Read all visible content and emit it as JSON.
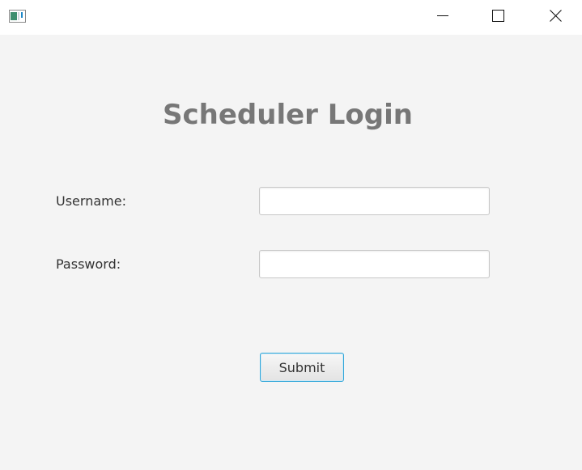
{
  "window": {
    "icon": "app-window-icon",
    "controls": {
      "minimize_icon": "minimize-icon",
      "maximize_icon": "maximize-icon",
      "close_icon": "close-icon"
    }
  },
  "login": {
    "title": "Scheduler Login",
    "username_label": "Username:",
    "username_value": "",
    "password_label": "Password:",
    "password_value": "",
    "submit_label": "Submit"
  },
  "colors": {
    "background": "#f4f4f4",
    "title": "#777777",
    "focus_border": "#2fa6d9"
  }
}
